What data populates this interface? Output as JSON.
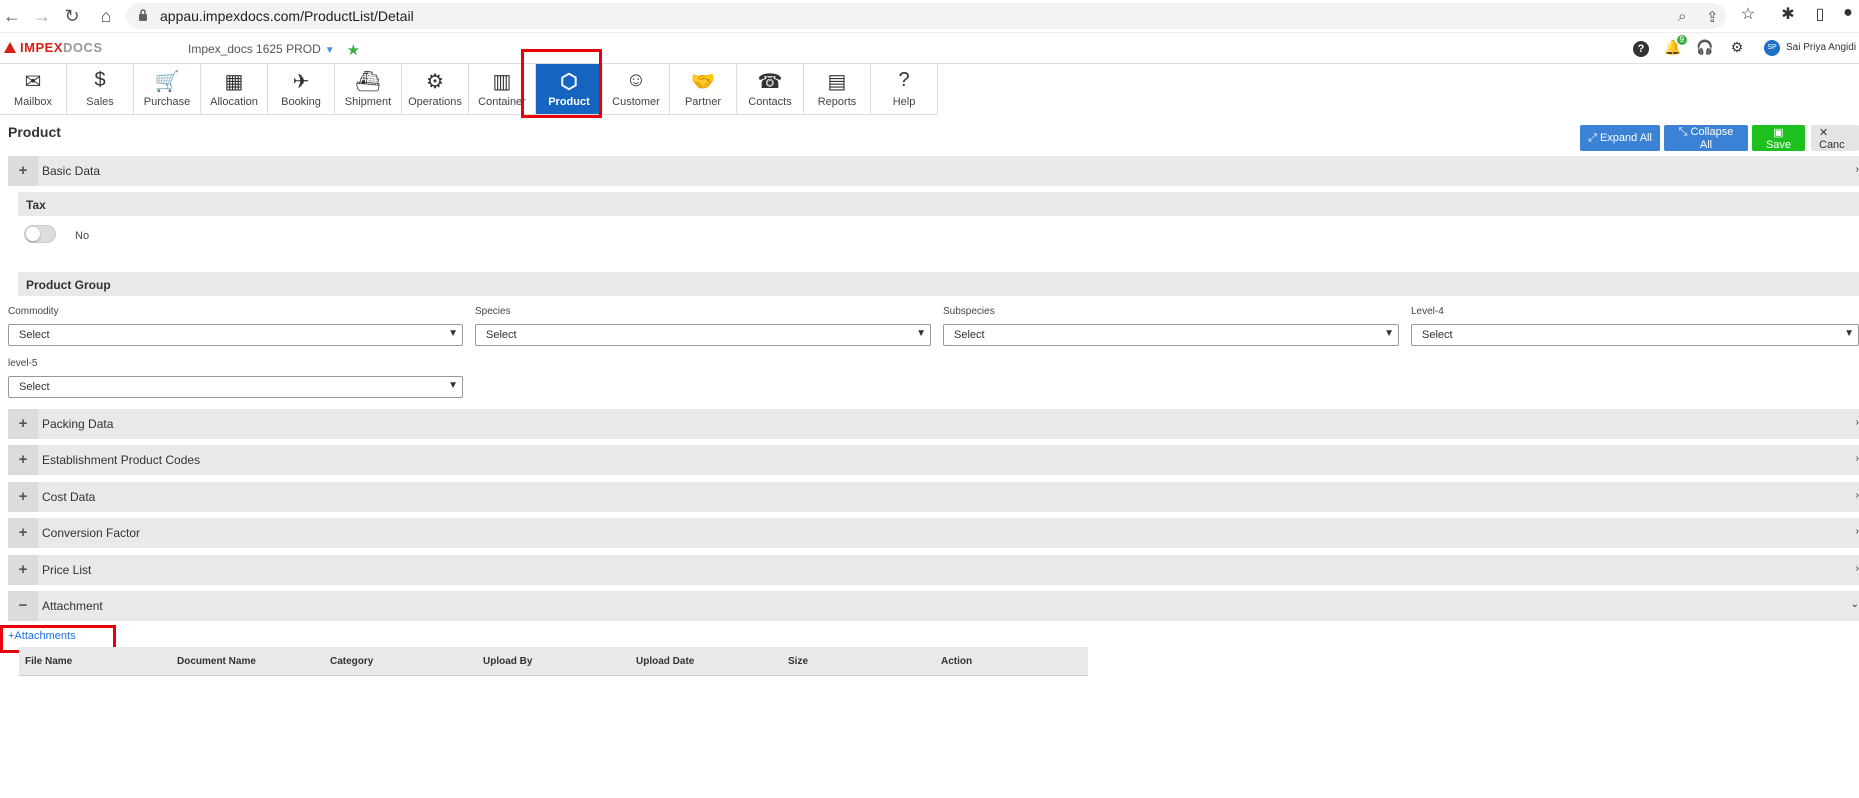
{
  "browser": {
    "url": "appau.impexdocs.com/ProductList/Detail",
    "back_icon": "back-arrow-icon",
    "forward_icon": "forward-arrow-icon",
    "reload_icon": "reload-icon",
    "home_icon": "home-icon"
  },
  "app_header": {
    "logo_impex": "IMPEX",
    "logo_docs": "DOCS",
    "company": "Impex_docs 1625 PROD",
    "user_initials": "SP",
    "user_name": "Sai Priya Angidi",
    "notification_count": "9",
    "colors": {
      "accent": "#1565c0",
      "brand_red": "#d91e18",
      "save_green": "#1ec01e",
      "button_blue": "#3b82d6"
    }
  },
  "modules": [
    {
      "label": "Mailbox",
      "icon": "mailbox-icon"
    },
    {
      "label": "Sales",
      "icon": "dollar-icon"
    },
    {
      "label": "Purchase",
      "icon": "cart-icon"
    },
    {
      "label": "Allocation",
      "icon": "boxes-icon"
    },
    {
      "label": "Booking",
      "icon": "paper-plane-icon"
    },
    {
      "label": "Shipment",
      "icon": "ship-icon"
    },
    {
      "label": "Operations",
      "icon": "gear-icon"
    },
    {
      "label": "Container",
      "icon": "container-icon"
    },
    {
      "label": "Product",
      "icon": "product-box-icon",
      "active": true
    },
    {
      "label": "Customer",
      "icon": "user-icon"
    },
    {
      "label": "Partner",
      "icon": "handshake-icon"
    },
    {
      "label": "Contacts",
      "icon": "phone-icon"
    },
    {
      "label": "Reports",
      "icon": "report-icon"
    },
    {
      "label": "Help",
      "icon": "help-icon"
    }
  ],
  "page": {
    "title": "Product",
    "expand_all": "Expand All",
    "collapse_all": "Collapse All",
    "save": "Save",
    "cancel": "Canc"
  },
  "sections": {
    "basic_data": "Basic Data",
    "packing_data": "Packing Data",
    "establishment_codes": "Establishment Product Codes",
    "cost_data": "Cost Data",
    "conversion_factor": "Conversion Factor",
    "price_list": "Price List",
    "attachment": "Attachment"
  },
  "tax": {
    "heading": "Tax",
    "toggle_value": "No"
  },
  "product_group": {
    "heading": "Product Group",
    "fields": {
      "commodity": {
        "label": "Commodity",
        "value": "Select"
      },
      "species": {
        "label": "Species",
        "value": "Select"
      },
      "subspecies": {
        "label": "Subspecies",
        "value": "Select"
      },
      "level4": {
        "label": "Level-4",
        "value": "Select"
      },
      "level5": {
        "label": "level-5",
        "value": "Select"
      }
    }
  },
  "attachments": {
    "add_link": "+Attachments",
    "columns": [
      "File Name",
      "Document Name",
      "Category",
      "Upload By",
      "Upload Date",
      "Size",
      "Action"
    ]
  }
}
